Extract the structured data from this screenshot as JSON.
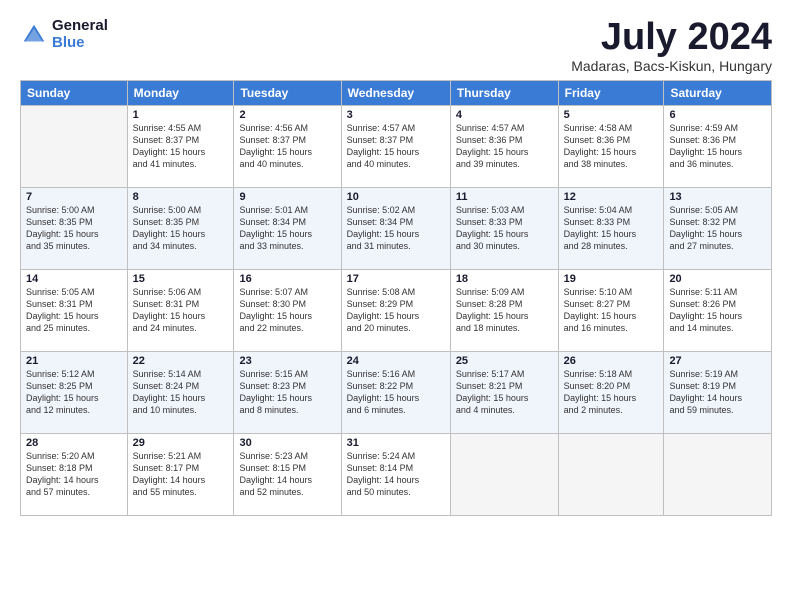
{
  "logo": {
    "general": "General",
    "blue": "Blue"
  },
  "title": "July 2024",
  "location": "Madaras, Bacs-Kiskun, Hungary",
  "header_days": [
    "Sunday",
    "Monday",
    "Tuesday",
    "Wednesday",
    "Thursday",
    "Friday",
    "Saturday"
  ],
  "weeks": [
    [
      {
        "num": "",
        "info": ""
      },
      {
        "num": "1",
        "info": "Sunrise: 4:55 AM\nSunset: 8:37 PM\nDaylight: 15 hours\nand 41 minutes."
      },
      {
        "num": "2",
        "info": "Sunrise: 4:56 AM\nSunset: 8:37 PM\nDaylight: 15 hours\nand 40 minutes."
      },
      {
        "num": "3",
        "info": "Sunrise: 4:57 AM\nSunset: 8:37 PM\nDaylight: 15 hours\nand 40 minutes."
      },
      {
        "num": "4",
        "info": "Sunrise: 4:57 AM\nSunset: 8:36 PM\nDaylight: 15 hours\nand 39 minutes."
      },
      {
        "num": "5",
        "info": "Sunrise: 4:58 AM\nSunset: 8:36 PM\nDaylight: 15 hours\nand 38 minutes."
      },
      {
        "num": "6",
        "info": "Sunrise: 4:59 AM\nSunset: 8:36 PM\nDaylight: 15 hours\nand 36 minutes."
      }
    ],
    [
      {
        "num": "7",
        "info": "Sunrise: 5:00 AM\nSunset: 8:35 PM\nDaylight: 15 hours\nand 35 minutes."
      },
      {
        "num": "8",
        "info": "Sunrise: 5:00 AM\nSunset: 8:35 PM\nDaylight: 15 hours\nand 34 minutes."
      },
      {
        "num": "9",
        "info": "Sunrise: 5:01 AM\nSunset: 8:34 PM\nDaylight: 15 hours\nand 33 minutes."
      },
      {
        "num": "10",
        "info": "Sunrise: 5:02 AM\nSunset: 8:34 PM\nDaylight: 15 hours\nand 31 minutes."
      },
      {
        "num": "11",
        "info": "Sunrise: 5:03 AM\nSunset: 8:33 PM\nDaylight: 15 hours\nand 30 minutes."
      },
      {
        "num": "12",
        "info": "Sunrise: 5:04 AM\nSunset: 8:33 PM\nDaylight: 15 hours\nand 28 minutes."
      },
      {
        "num": "13",
        "info": "Sunrise: 5:05 AM\nSunset: 8:32 PM\nDaylight: 15 hours\nand 27 minutes."
      }
    ],
    [
      {
        "num": "14",
        "info": "Sunrise: 5:05 AM\nSunset: 8:31 PM\nDaylight: 15 hours\nand 25 minutes."
      },
      {
        "num": "15",
        "info": "Sunrise: 5:06 AM\nSunset: 8:31 PM\nDaylight: 15 hours\nand 24 minutes."
      },
      {
        "num": "16",
        "info": "Sunrise: 5:07 AM\nSunset: 8:30 PM\nDaylight: 15 hours\nand 22 minutes."
      },
      {
        "num": "17",
        "info": "Sunrise: 5:08 AM\nSunset: 8:29 PM\nDaylight: 15 hours\nand 20 minutes."
      },
      {
        "num": "18",
        "info": "Sunrise: 5:09 AM\nSunset: 8:28 PM\nDaylight: 15 hours\nand 18 minutes."
      },
      {
        "num": "19",
        "info": "Sunrise: 5:10 AM\nSunset: 8:27 PM\nDaylight: 15 hours\nand 16 minutes."
      },
      {
        "num": "20",
        "info": "Sunrise: 5:11 AM\nSunset: 8:26 PM\nDaylight: 15 hours\nand 14 minutes."
      }
    ],
    [
      {
        "num": "21",
        "info": "Sunrise: 5:12 AM\nSunset: 8:25 PM\nDaylight: 15 hours\nand 12 minutes."
      },
      {
        "num": "22",
        "info": "Sunrise: 5:14 AM\nSunset: 8:24 PM\nDaylight: 15 hours\nand 10 minutes."
      },
      {
        "num": "23",
        "info": "Sunrise: 5:15 AM\nSunset: 8:23 PM\nDaylight: 15 hours\nand 8 minutes."
      },
      {
        "num": "24",
        "info": "Sunrise: 5:16 AM\nSunset: 8:22 PM\nDaylight: 15 hours\nand 6 minutes."
      },
      {
        "num": "25",
        "info": "Sunrise: 5:17 AM\nSunset: 8:21 PM\nDaylight: 15 hours\nand 4 minutes."
      },
      {
        "num": "26",
        "info": "Sunrise: 5:18 AM\nSunset: 8:20 PM\nDaylight: 15 hours\nand 2 minutes."
      },
      {
        "num": "27",
        "info": "Sunrise: 5:19 AM\nSunset: 8:19 PM\nDaylight: 14 hours\nand 59 minutes."
      }
    ],
    [
      {
        "num": "28",
        "info": "Sunrise: 5:20 AM\nSunset: 8:18 PM\nDaylight: 14 hours\nand 57 minutes."
      },
      {
        "num": "29",
        "info": "Sunrise: 5:21 AM\nSunset: 8:17 PM\nDaylight: 14 hours\nand 55 minutes."
      },
      {
        "num": "30",
        "info": "Sunrise: 5:23 AM\nSunset: 8:15 PM\nDaylight: 14 hours\nand 52 minutes."
      },
      {
        "num": "31",
        "info": "Sunrise: 5:24 AM\nSunset: 8:14 PM\nDaylight: 14 hours\nand 50 minutes."
      },
      {
        "num": "",
        "info": ""
      },
      {
        "num": "",
        "info": ""
      },
      {
        "num": "",
        "info": ""
      }
    ]
  ]
}
